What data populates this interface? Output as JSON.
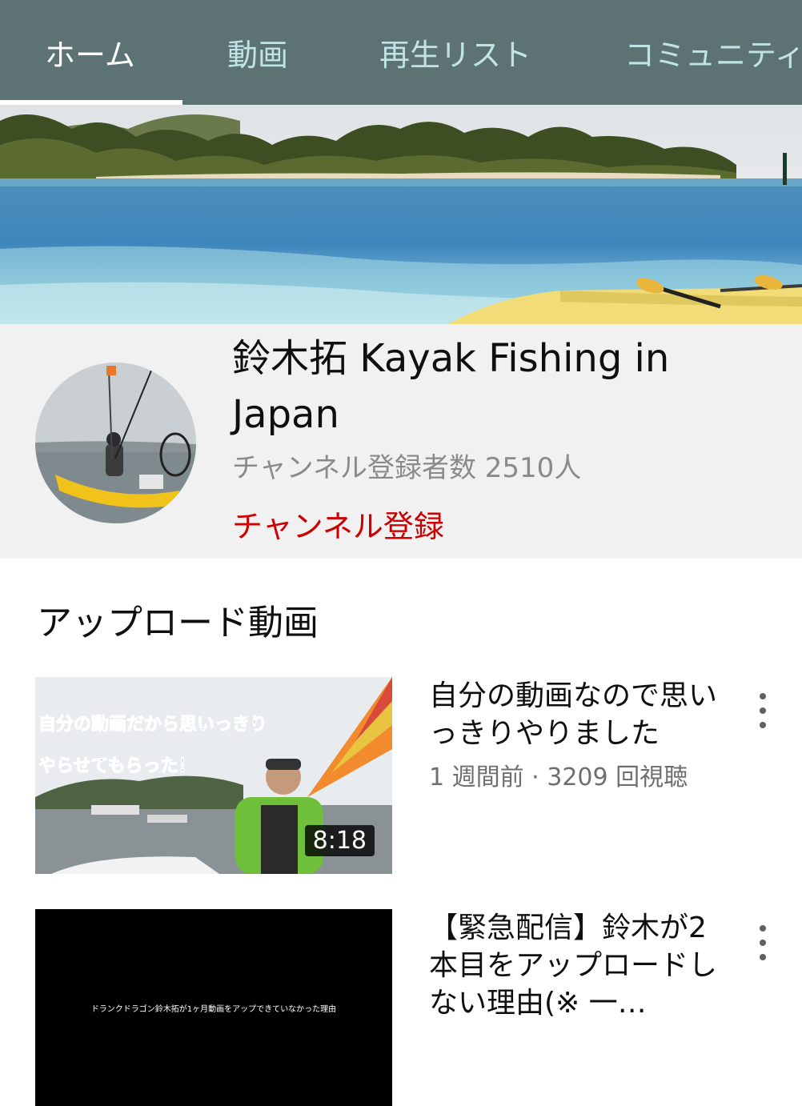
{
  "tabs": [
    {
      "label": "ホーム",
      "active": true
    },
    {
      "label": "動画",
      "active": false
    },
    {
      "label": "再生リスト",
      "active": false
    },
    {
      "label": "コミュニティ",
      "active": false
    }
  ],
  "channel": {
    "name": "鈴木拓 Kayak Fishing in Japan",
    "subscriber_text": "チャンネル登録者数 2510人",
    "subscribe_label": "チャンネル登録"
  },
  "uploads": {
    "section_title": "アップロード動画",
    "videos": [
      {
        "title": "自分の動画なので思いっきりやりました",
        "meta": "1 週間前 · 3209 回視聴",
        "duration": "8:18",
        "thumb_text_line1": "自分の動画だから思いっきり",
        "thumb_text_line2": "やらせてもらった！"
      },
      {
        "title": "【緊急配信】鈴木が2本目をアップロードしない理由(※ 一…",
        "thumb_caption": "ドランクドラゴン鈴木拓が1ヶ月動画をアップできていなかった理由"
      }
    ]
  },
  "colors": {
    "tab_bar_bg": "#5d7373",
    "tab_active": "#ffffff",
    "tab_inactive": "#bfe3e6",
    "subscribe_red": "#cc0000",
    "header_bg": "#f1f1f1"
  },
  "icons": {
    "more": "more-vert-icon"
  }
}
